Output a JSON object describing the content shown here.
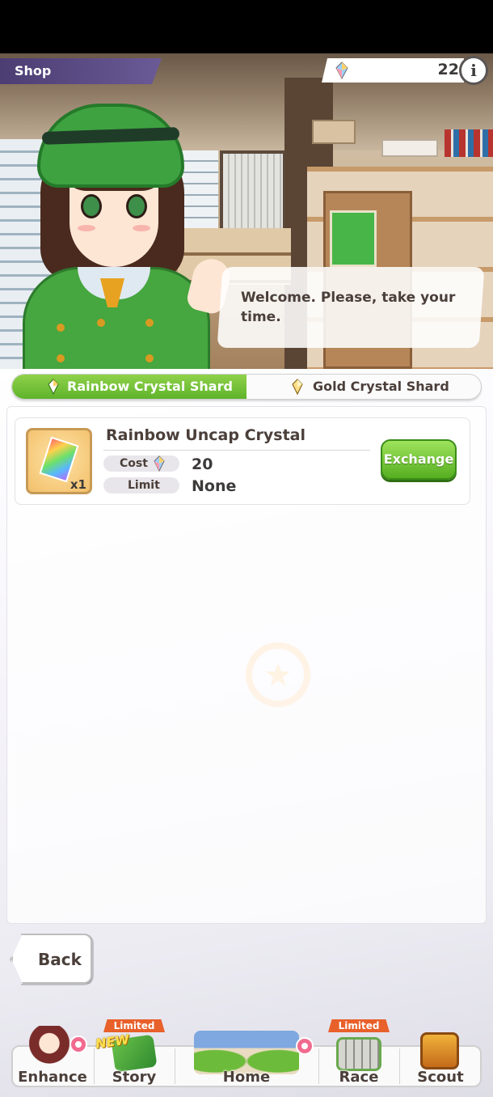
{
  "header": {
    "title": "Shop",
    "currency_amount": "22",
    "currency_icon": "rainbow-shard-icon",
    "info_label": "i"
  },
  "dialogue": {
    "text": "Welcome. Please, take your time."
  },
  "tabs": [
    {
      "label": "Rainbow Crystal Shard",
      "icon": "rainbow-shard-icon",
      "active": true
    },
    {
      "label": "Gold Crystal Shard",
      "icon": "gold-shard-icon",
      "active": false
    }
  ],
  "items": [
    {
      "name": "Rainbow Uncap Crystal",
      "quantity": "x1",
      "cost_label": "Cost",
      "cost_value": "20",
      "limit_label": "Limit",
      "limit_value": "None",
      "button_label": "Exchange"
    }
  ],
  "back_label": "Back",
  "nav": {
    "items": [
      {
        "label": "Enhance"
      },
      {
        "label": "Story",
        "badge": "Limited Time",
        "tag": "NEW"
      },
      {
        "label": "Home"
      },
      {
        "label": "Race",
        "badge": "Limited Time"
      },
      {
        "label": "Scout"
      }
    ]
  },
  "colors": {
    "accent_green": "#5fb32b",
    "text_brown": "#4b3f3a",
    "badge_orange": "#e8602a"
  }
}
